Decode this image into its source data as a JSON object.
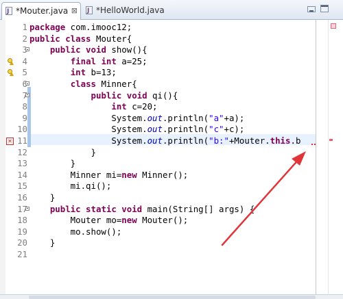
{
  "tabs": [
    {
      "label": "*Mouter.java",
      "active": true,
      "close": "⊠"
    },
    {
      "label": "*HelloWorld.java",
      "active": false
    }
  ],
  "window_buttons": [
    "minimize-icon",
    "maximize-icon"
  ],
  "colors": {
    "keyword": "#7f0055",
    "string": "#2a00ff",
    "static_field": "#0000c0",
    "current_line": "#e8f2fe",
    "error_mark": "#f05a6e",
    "warning_mark": "#f2c96a",
    "annotation_arrow": "#e0363a"
  },
  "code_lines": [
    {
      "n": "1",
      "tokens": [
        {
          "k": "kw",
          "t": "package"
        },
        {
          "k": "t",
          "t": " com.imooc12;"
        }
      ]
    },
    {
      "n": "2",
      "tokens": [
        {
          "k": "kw",
          "t": "public class"
        },
        {
          "k": "t",
          "t": " Mouter{"
        }
      ]
    },
    {
      "n": "3",
      "fold": true,
      "tokens": [
        {
          "k": "t",
          "t": "    "
        },
        {
          "k": "kw",
          "t": "public void"
        },
        {
          "k": "t",
          "t": " show(){"
        }
      ]
    },
    {
      "n": "4",
      "marker": "warning",
      "tokens": [
        {
          "k": "t",
          "t": "        "
        },
        {
          "k": "kw",
          "t": "final int"
        },
        {
          "k": "t",
          "t": " a=25;"
        }
      ]
    },
    {
      "n": "5",
      "marker": "warning",
      "tokens": [
        {
          "k": "t",
          "t": "        "
        },
        {
          "k": "kw",
          "t": "int"
        },
        {
          "k": "t",
          "t": " b=13;"
        }
      ]
    },
    {
      "n": "6",
      "fold": true,
      "tokens": [
        {
          "k": "t",
          "t": "        "
        },
        {
          "k": "kw",
          "t": "class"
        },
        {
          "k": "t",
          "t": " Minner{"
        }
      ]
    },
    {
      "n": "7",
      "fold": true,
      "tokens": [
        {
          "k": "t",
          "t": "            "
        },
        {
          "k": "kw",
          "t": "public void"
        },
        {
          "k": "t",
          "t": " qi(){"
        }
      ]
    },
    {
      "n": "8",
      "tokens": [
        {
          "k": "t",
          "t": "                "
        },
        {
          "k": "kw",
          "t": "int"
        },
        {
          "k": "t",
          "t": " c=20;"
        }
      ]
    },
    {
      "n": "9",
      "tokens": [
        {
          "k": "t",
          "t": "                System."
        },
        {
          "k": "st",
          "t": "out"
        },
        {
          "k": "t",
          "t": ".println("
        },
        {
          "k": "str",
          "t": "\"a\""
        },
        {
          "k": "t",
          "t": "+a);"
        }
      ]
    },
    {
      "n": "10",
      "tokens": [
        {
          "k": "t",
          "t": "                System."
        },
        {
          "k": "st",
          "t": "out"
        },
        {
          "k": "t",
          "t": ".println("
        },
        {
          "k": "str",
          "t": "\"c\""
        },
        {
          "k": "t",
          "t": "+c);"
        }
      ]
    },
    {
      "n": "11",
      "marker": "error",
      "current": true,
      "tokens": [
        {
          "k": "t",
          "t": "                System."
        },
        {
          "k": "st",
          "t": "out"
        },
        {
          "k": "t",
          "t": ".println("
        },
        {
          "k": "str",
          "t": "\"b:\""
        },
        {
          "k": "t",
          "t": "+Mouter."
        },
        {
          "k": "kw",
          "t": "this"
        },
        {
          "k": "t",
          "t": ".b"
        }
      ]
    },
    {
      "n": "12",
      "tokens": [
        {
          "k": "t",
          "t": "            }"
        }
      ]
    },
    {
      "n": "13",
      "tokens": [
        {
          "k": "t",
          "t": "        }"
        }
      ]
    },
    {
      "n": "14",
      "tokens": [
        {
          "k": "t",
          "t": "        Minner mi="
        },
        {
          "k": "kw",
          "t": "new"
        },
        {
          "k": "t",
          "t": " Minner();"
        }
      ]
    },
    {
      "n": "15",
      "tokens": [
        {
          "k": "t",
          "t": "        mi.qi();"
        }
      ]
    },
    {
      "n": "16",
      "tokens": [
        {
          "k": "t",
          "t": "    }"
        }
      ]
    },
    {
      "n": "17",
      "fold": true,
      "tokens": [
        {
          "k": "t",
          "t": "    "
        },
        {
          "k": "kw",
          "t": "public static void"
        },
        {
          "k": "t",
          "t": " main(String[] args) {"
        }
      ]
    },
    {
      "n": "18",
      "tokens": [
        {
          "k": "t",
          "t": "        Mouter mo="
        },
        {
          "k": "kw",
          "t": "new"
        },
        {
          "k": "t",
          "t": " Mouter();"
        }
      ]
    },
    {
      "n": "19",
      "tokens": [
        {
          "k": "t",
          "t": "        mo.show();"
        }
      ]
    },
    {
      "n": "20",
      "tokens": [
        {
          "k": "t",
          "t": "    }"
        }
      ]
    },
    {
      "n": "21",
      "tokens": []
    }
  ],
  "error_icon_label": "✕"
}
